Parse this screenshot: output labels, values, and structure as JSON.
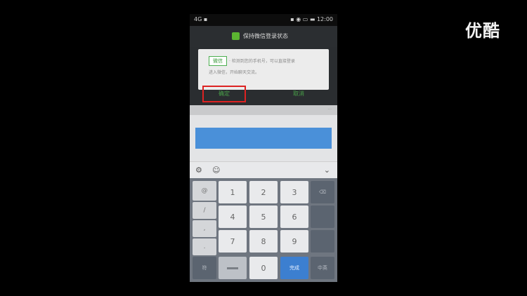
{
  "watermark": "优酷",
  "statusbar": {
    "left": "4G ▪",
    "right": "▪ ◉ ▭ ▬ 12:00"
  },
  "dialog": {
    "title": "保持微信登录状态",
    "card_tag": "微信",
    "card_line1": "· 检测到您的手机号，可以直接登录",
    "card_line2": "进入微信，开始聊天交流。",
    "btn_left": "确定",
    "btn_right": "取消"
  },
  "input_hint": "···",
  "keyboard": {
    "digits": [
      "1",
      "2",
      "3",
      "4",
      "5",
      "6",
      "7",
      "8",
      "9",
      "0"
    ],
    "side_keys": [
      "@",
      "/",
      ",",
      ".",
      "?"
    ],
    "delete_label": "⌫",
    "symbol_label": "符",
    "enter_label": "完成",
    "switch_label": "中英"
  },
  "toolbar": {
    "gear": "⚙",
    "emoji": "☺",
    "collapse": "⌄"
  },
  "colors": {
    "input_blue": "#4a90d9",
    "confirm_border": "#dd2222",
    "accent_green": "#48a048"
  }
}
